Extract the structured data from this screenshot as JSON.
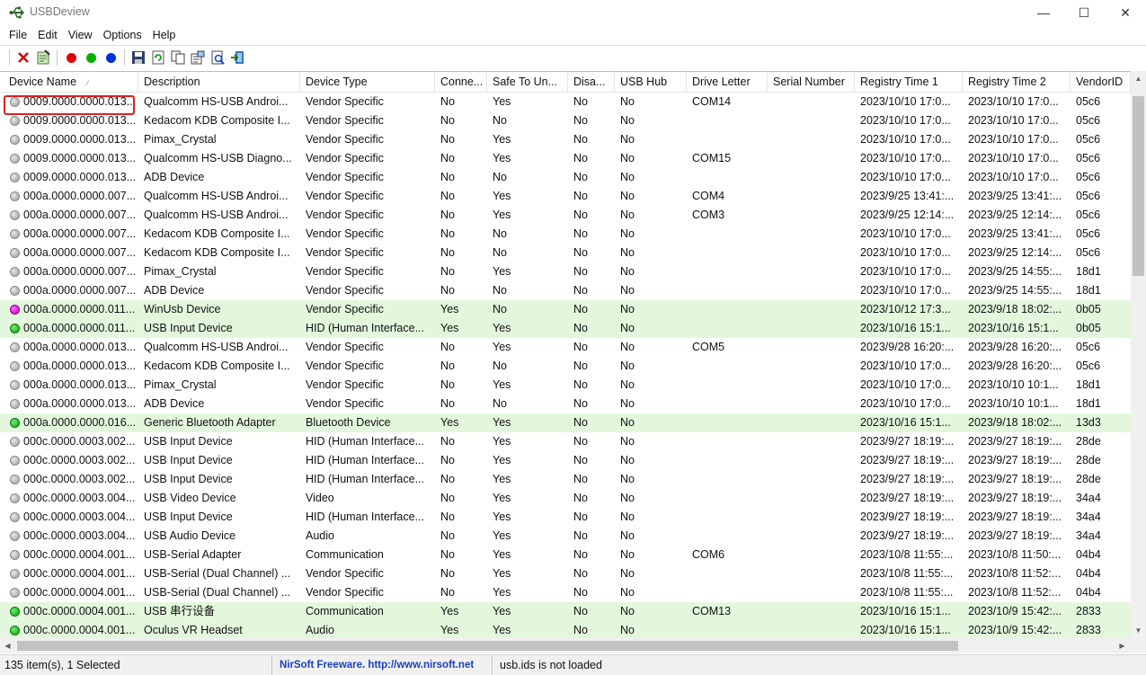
{
  "window": {
    "title": "USBDeview",
    "min_glyph": "—",
    "max_glyph": "☐",
    "close_glyph": "✕"
  },
  "menu": [
    "File",
    "Edit",
    "View",
    "Options",
    "Help"
  ],
  "toolbar": {
    "icons": [
      "delete-icon",
      "uninstall-icon",
      "disconnect-icon",
      "connect-icon",
      "reconnect-icon",
      "save-icon",
      "refresh-icon",
      "copy-icon",
      "properties-icon",
      "html-report-icon",
      "exit-icon"
    ],
    "colors": {
      "red": "#e00000",
      "green": "#00b000",
      "blue": "#0030e0"
    }
  },
  "columns": [
    "Device Name",
    "Description",
    "Device Type",
    "Conne...",
    "Safe To Un...",
    "Disa...",
    "USB Hub",
    "Drive Letter",
    "Serial Number",
    "Registry Time 1",
    "Registry Time 2",
    "VendorID"
  ],
  "sort_indicator": "⁄",
  "rows": [
    {
      "status": "gray",
      "green": false,
      "cells": [
        "0009.0000.0000.013...",
        "Qualcomm HS-USB Androi...",
        "Vendor Specific",
        "No",
        "Yes",
        "No",
        "No",
        "COM14",
        "",
        "2023/10/10 17:0...",
        "2023/10/10 17:0...",
        "05c6"
      ]
    },
    {
      "status": "gray",
      "green": false,
      "cells": [
        "0009.0000.0000.013...",
        "Kedacom KDB Composite I...",
        "Vendor Specific",
        "No",
        "No",
        "No",
        "No",
        "",
        "",
        "2023/10/10 17:0...",
        "2023/10/10 17:0...",
        "05c6"
      ]
    },
    {
      "status": "gray",
      "green": false,
      "cells": [
        "0009.0000.0000.013...",
        "Pimax_Crystal",
        "Vendor Specific",
        "No",
        "Yes",
        "No",
        "No",
        "",
        "",
        "2023/10/10 17:0...",
        "2023/10/10 17:0...",
        "05c6"
      ]
    },
    {
      "status": "gray",
      "green": false,
      "cells": [
        "0009.0000.0000.013...",
        "Qualcomm HS-USB Diagno...",
        "Vendor Specific",
        "No",
        "Yes",
        "No",
        "No",
        "COM15",
        "",
        "2023/10/10 17:0...",
        "2023/10/10 17:0...",
        "05c6"
      ]
    },
    {
      "status": "gray",
      "green": false,
      "cells": [
        "0009.0000.0000.013...",
        "ADB Device",
        "Vendor Specific",
        "No",
        "No",
        "No",
        "No",
        "",
        "",
        "2023/10/10 17:0...",
        "2023/10/10 17:0...",
        "05c6"
      ]
    },
    {
      "status": "gray",
      "green": false,
      "cells": [
        "000a.0000.0000.007...",
        "Qualcomm HS-USB Androi...",
        "Vendor Specific",
        "No",
        "Yes",
        "No",
        "No",
        "COM4",
        "",
        "2023/9/25 13:41:...",
        "2023/9/25 13:41:...",
        "05c6"
      ]
    },
    {
      "status": "gray",
      "green": false,
      "cells": [
        "000a.0000.0000.007...",
        "Qualcomm HS-USB Androi...",
        "Vendor Specific",
        "No",
        "Yes",
        "No",
        "No",
        "COM3",
        "",
        "2023/9/25 12:14:...",
        "2023/9/25 12:14:...",
        "05c6"
      ]
    },
    {
      "status": "gray",
      "green": false,
      "cells": [
        "000a.0000.0000.007...",
        "Kedacom KDB Composite I...",
        "Vendor Specific",
        "No",
        "No",
        "No",
        "No",
        "",
        "",
        "2023/10/10 17:0...",
        "2023/9/25 13:41:...",
        "05c6"
      ]
    },
    {
      "status": "gray",
      "green": false,
      "cells": [
        "000a.0000.0000.007...",
        "Kedacom KDB Composite I...",
        "Vendor Specific",
        "No",
        "No",
        "No",
        "No",
        "",
        "",
        "2023/10/10 17:0...",
        "2023/9/25 12:14:...",
        "05c6"
      ]
    },
    {
      "status": "gray",
      "green": false,
      "cells": [
        "000a.0000.0000.007...",
        "Pimax_Crystal",
        "Vendor Specific",
        "No",
        "Yes",
        "No",
        "No",
        "",
        "",
        "2023/10/10 17:0...",
        "2023/9/25 14:55:...",
        "18d1"
      ]
    },
    {
      "status": "gray",
      "green": false,
      "cells": [
        "000a.0000.0000.007...",
        "ADB Device",
        "Vendor Specific",
        "No",
        "No",
        "No",
        "No",
        "",
        "",
        "2023/10/10 17:0...",
        "2023/9/25 14:55:...",
        "18d1"
      ]
    },
    {
      "status": "magenta",
      "green": true,
      "cells": [
        "000a.0000.0000.011...",
        "WinUsb Device",
        "Vendor Specific",
        "Yes",
        "No",
        "No",
        "No",
        "",
        "",
        "2023/10/12 17:3...",
        "2023/9/18 18:02:...",
        "0b05"
      ]
    },
    {
      "status": "green",
      "green": true,
      "cells": [
        "000a.0000.0000.011...",
        "USB Input Device",
        "HID (Human Interface...",
        "Yes",
        "Yes",
        "No",
        "No",
        "",
        "",
        "2023/10/16 15:1...",
        "2023/10/16 15:1...",
        "0b05"
      ]
    },
    {
      "status": "gray",
      "green": false,
      "cells": [
        "000a.0000.0000.013...",
        "Qualcomm HS-USB Androi...",
        "Vendor Specific",
        "No",
        "Yes",
        "No",
        "No",
        "COM5",
        "",
        "2023/9/28 16:20:...",
        "2023/9/28 16:20:...",
        "05c6"
      ]
    },
    {
      "status": "gray",
      "green": false,
      "cells": [
        "000a.0000.0000.013...",
        "Kedacom KDB Composite I...",
        "Vendor Specific",
        "No",
        "No",
        "No",
        "No",
        "",
        "",
        "2023/10/10 17:0...",
        "2023/9/28 16:20:...",
        "05c6"
      ]
    },
    {
      "status": "gray",
      "green": false,
      "cells": [
        "000a.0000.0000.013...",
        "Pimax_Crystal",
        "Vendor Specific",
        "No",
        "Yes",
        "No",
        "No",
        "",
        "",
        "2023/10/10 17:0...",
        "2023/10/10 10:1...",
        "18d1"
      ]
    },
    {
      "status": "gray",
      "green": false,
      "cells": [
        "000a.0000.0000.013...",
        "ADB Device",
        "Vendor Specific",
        "No",
        "No",
        "No",
        "No",
        "",
        "",
        "2023/10/10 17:0...",
        "2023/10/10 10:1...",
        "18d1"
      ]
    },
    {
      "status": "green",
      "green": true,
      "cells": [
        "000a.0000.0000.016...",
        "Generic Bluetooth Adapter",
        "Bluetooth Device",
        "Yes",
        "Yes",
        "No",
        "No",
        "",
        "",
        "2023/10/16 15:1...",
        "2023/9/18 18:02:...",
        "13d3"
      ]
    },
    {
      "status": "gray",
      "green": false,
      "cells": [
        "000c.0000.0003.002...",
        "USB Input Device",
        "HID (Human Interface...",
        "No",
        "Yes",
        "No",
        "No",
        "",
        "",
        "2023/9/27 18:19:...",
        "2023/9/27 18:19:...",
        "28de"
      ]
    },
    {
      "status": "gray",
      "green": false,
      "cells": [
        "000c.0000.0003.002...",
        "USB Input Device",
        "HID (Human Interface...",
        "No",
        "Yes",
        "No",
        "No",
        "",
        "",
        "2023/9/27 18:19:...",
        "2023/9/27 18:19:...",
        "28de"
      ]
    },
    {
      "status": "gray",
      "green": false,
      "cells": [
        "000c.0000.0003.002...",
        "USB Input Device",
        "HID (Human Interface...",
        "No",
        "Yes",
        "No",
        "No",
        "",
        "",
        "2023/9/27 18:19:...",
        "2023/9/27 18:19:...",
        "28de"
      ]
    },
    {
      "status": "gray",
      "green": false,
      "cells": [
        "000c.0000.0003.004...",
        "USB Video Device",
        "Video",
        "No",
        "Yes",
        "No",
        "No",
        "",
        "",
        "2023/9/27 18:19:...",
        "2023/9/27 18:19:...",
        "34a4"
      ]
    },
    {
      "status": "gray",
      "green": false,
      "cells": [
        "000c.0000.0003.004...",
        "USB Input Device",
        "HID (Human Interface...",
        "No",
        "Yes",
        "No",
        "No",
        "",
        "",
        "2023/9/27 18:19:...",
        "2023/9/27 18:19:...",
        "34a4"
      ]
    },
    {
      "status": "gray",
      "green": false,
      "cells": [
        "000c.0000.0003.004...",
        "USB Audio Device",
        "Audio",
        "No",
        "Yes",
        "No",
        "No",
        "",
        "",
        "2023/9/27 18:19:...",
        "2023/9/27 18:19:...",
        "34a4"
      ]
    },
    {
      "status": "gray",
      "green": false,
      "cells": [
        "000c.0000.0004.001...",
        "USB-Serial Adapter",
        "Communication",
        "No",
        "Yes",
        "No",
        "No",
        "COM6",
        "",
        "2023/10/8 11:55:...",
        "2023/10/8 11:50:...",
        "04b4"
      ]
    },
    {
      "status": "gray",
      "green": false,
      "cells": [
        "000c.0000.0004.001...",
        "USB-Serial (Dual Channel) ...",
        "Vendor Specific",
        "No",
        "Yes",
        "No",
        "No",
        "",
        "",
        "2023/10/8 11:55:...",
        "2023/10/8 11:52:...",
        "04b4"
      ]
    },
    {
      "status": "gray",
      "green": false,
      "cells": [
        "000c.0000.0004.001...",
        "USB-Serial (Dual Channel) ...",
        "Vendor Specific",
        "No",
        "Yes",
        "No",
        "No",
        "",
        "",
        "2023/10/8 11:55:...",
        "2023/10/8 11:52:...",
        "04b4"
      ]
    },
    {
      "status": "green",
      "green": true,
      "cells": [
        "000c.0000.0004.001...",
        "USB 串行设备",
        "Communication",
        "Yes",
        "Yes",
        "No",
        "No",
        "COM13",
        "",
        "2023/10/16 15:1...",
        "2023/10/9 15:42:...",
        "2833"
      ]
    },
    {
      "status": "green",
      "green": true,
      "cells": [
        "000c.0000.0004.001...",
        "Oculus VR Headset",
        "Audio",
        "Yes",
        "Yes",
        "No",
        "No",
        "",
        "",
        "2023/10/16 15:1...",
        "2023/10/9 15:42:...",
        "2833"
      ]
    }
  ],
  "scroll": {
    "up": "▲",
    "down": "▼",
    "left": "◀",
    "right": "▶"
  },
  "statusbar": {
    "items": "135 item(s), 1 Selected",
    "freeware": "NirSoft Freeware.  http://www.nirsoft.net",
    "ids": "usb.ids is not loaded"
  }
}
